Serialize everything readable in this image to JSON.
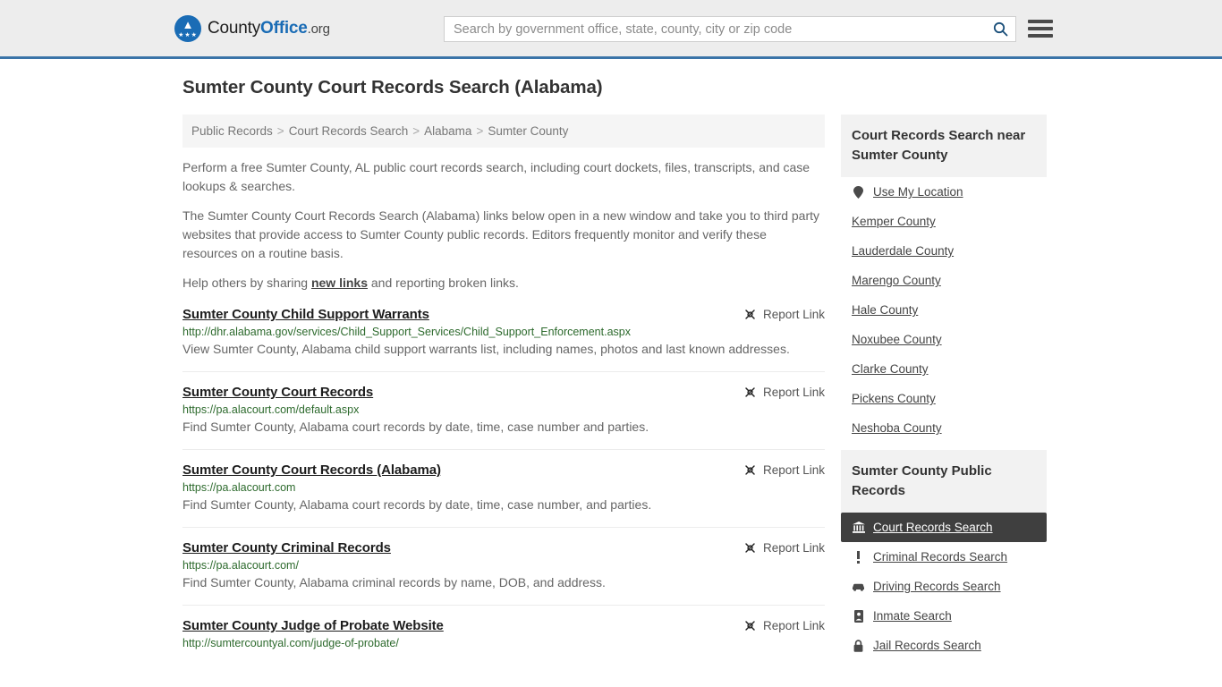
{
  "header": {
    "logo": {
      "prefix": "County",
      "accent": "Office",
      "suffix": ".org",
      "icon": "eagle-seal-icon"
    },
    "search": {
      "placeholder": "Search by government office, state, county, city or zip code",
      "value": "",
      "search_icon": "search-icon"
    },
    "menu_icon": "hamburger-menu-icon",
    "accent_color": "#1a6cb5",
    "border_color": "#3a74a8"
  },
  "page": {
    "title": "Sumter County Court Records Search (Alabama)"
  },
  "breadcrumb": {
    "items": [
      "Public Records",
      "Court Records Search",
      "Alabama",
      "Sumter County"
    ],
    "separator": ">"
  },
  "intro": {
    "p1": "Perform a free Sumter County, AL public court records search, including court dockets, files, transcripts, and case lookups & searches.",
    "p2": "The Sumter County Court Records Search (Alabama) links below open in a new window and take you to third party websites that provide access to Sumter County public records. Editors frequently monitor and verify these resources on a routine basis.",
    "p3_before": "Help others by sharing ",
    "p3_link": "new links",
    "p3_after": " and reporting broken links."
  },
  "results": {
    "report_label": "Report Link",
    "report_icon": "broken-link-icon",
    "items": [
      {
        "title": "Sumter County Child Support Warrants",
        "url": "http://dhr.alabama.gov/services/Child_Support_Services/Child_Support_Enforcement.aspx",
        "description": "View Sumter County, Alabama child support warrants list, including names, photos and last known addresses."
      },
      {
        "title": "Sumter County Court Records",
        "url": "https://pa.alacourt.com/default.aspx",
        "description": "Find Sumter County, Alabama court records by date, time, case number and parties."
      },
      {
        "title": "Sumter County Court Records (Alabama)",
        "url": "https://pa.alacourt.com",
        "description": "Find Sumter County, Alabama court records by date, time, case number, and parties."
      },
      {
        "title": "Sumter County Criminal Records",
        "url": "https://pa.alacourt.com/",
        "description": "Find Sumter County, Alabama criminal records by name, DOB, and address."
      },
      {
        "title": "Sumter County Judge of Probate Website",
        "url": "http://sumtercountyal.com/judge-of-probate/",
        "description": ""
      }
    ]
  },
  "sidebar": {
    "nearby": {
      "heading": "Court Records Search near Sumter County",
      "items": [
        {
          "label": "Use My Location",
          "icon": "map-pin-icon"
        },
        {
          "label": "Kemper County",
          "icon": ""
        },
        {
          "label": "Lauderdale County",
          "icon": ""
        },
        {
          "label": "Marengo County",
          "icon": ""
        },
        {
          "label": "Hale County",
          "icon": ""
        },
        {
          "label": "Noxubee County",
          "icon": ""
        },
        {
          "label": "Clarke County",
          "icon": ""
        },
        {
          "label": "Pickens County",
          "icon": ""
        },
        {
          "label": "Neshoba County",
          "icon": ""
        }
      ]
    },
    "public_records": {
      "heading": "Sumter County Public Records",
      "items": [
        {
          "label": "Court Records Search",
          "icon": "courthouse-icon",
          "active": true
        },
        {
          "label": "Criminal Records Search",
          "icon": "exclamation-icon",
          "active": false
        },
        {
          "label": "Driving Records Search",
          "icon": "car-icon",
          "active": false
        },
        {
          "label": "Inmate Search",
          "icon": "id-card-icon",
          "active": false
        },
        {
          "label": "Jail Records Search",
          "icon": "lock-icon",
          "active": false
        }
      ]
    }
  }
}
